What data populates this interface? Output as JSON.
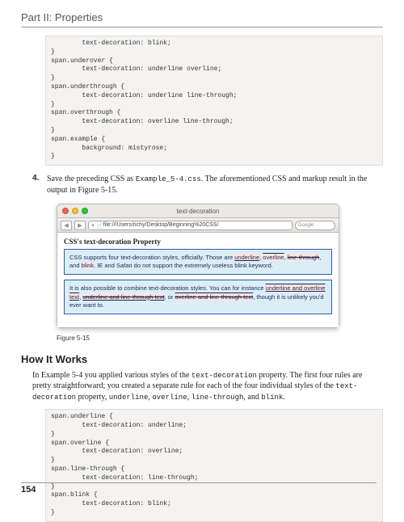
{
  "header": {
    "title": "Part II: Properties"
  },
  "code1": "        text-decoration: blink;\n}\nspan.underover {\n        text-decoration: underline overline;\n}\nspan.underthrough {\n        text-decoration: underline line-through;\n}\nspan.overthrough {\n        text-decoration: overline line-through;\n}\nspan.example {\n        background: mistyrose;\n}",
  "step": {
    "num": "4.",
    "pre": "Save the preceding CSS as ",
    "filename": "Example_5-4.css",
    "post": ". The aforementioned CSS and markup result in the output in Figure 5-15."
  },
  "browser": {
    "title": "text-decoration",
    "url": "file:///Users/richy/Desktop/Beginning%20CSS/",
    "search": "Google",
    "heading": "CSS's text-decoration Property",
    "box1": {
      "a": "CSS supports four text-decoration styles, officially. Those are ",
      "b": ", and ",
      "c": ". IE and Safari do not support the extremely useless blink keyword.",
      "kw_underline": "underline",
      "kw_overline": "overline",
      "kw_linethrough": "line-through",
      "kw_blink": "blink"
    },
    "box2": {
      "a": "It is also possible to combine text-decoration styles. You can for instance ",
      "b": ", or ",
      "c": ", though it is unlikely you'd ever want to.",
      "combo1": "underline and overline text",
      "combo2": "underline and line-through text",
      "combo3": "overline and line-through text"
    }
  },
  "figcaption": "Figure 5-15",
  "howitworks": {
    "heading": "How It Works",
    "p1a": "In Example 5-4 you applied various styles of the ",
    "p1b": " property. The first four rules are pretty straightforward; you created a separate rule for each of the four individual styles of the ",
    "p1c": " property, ",
    "p1d": ", and ",
    "p1e": ".",
    "prop": "text-decoration",
    "kw1": "underline",
    "kw2": "overline",
    "kw3": "line-through",
    "kw4": "blink"
  },
  "code2": "span.underline {\n        text-decoration: underline;\n}\nspan.overline {\n        text-decoration: overline;\n}\nspan.line-through {\n        text-decoration: line-through;\n}\nspan.blink {\n        text-decoration: blink;\n}",
  "pagenum": "154"
}
